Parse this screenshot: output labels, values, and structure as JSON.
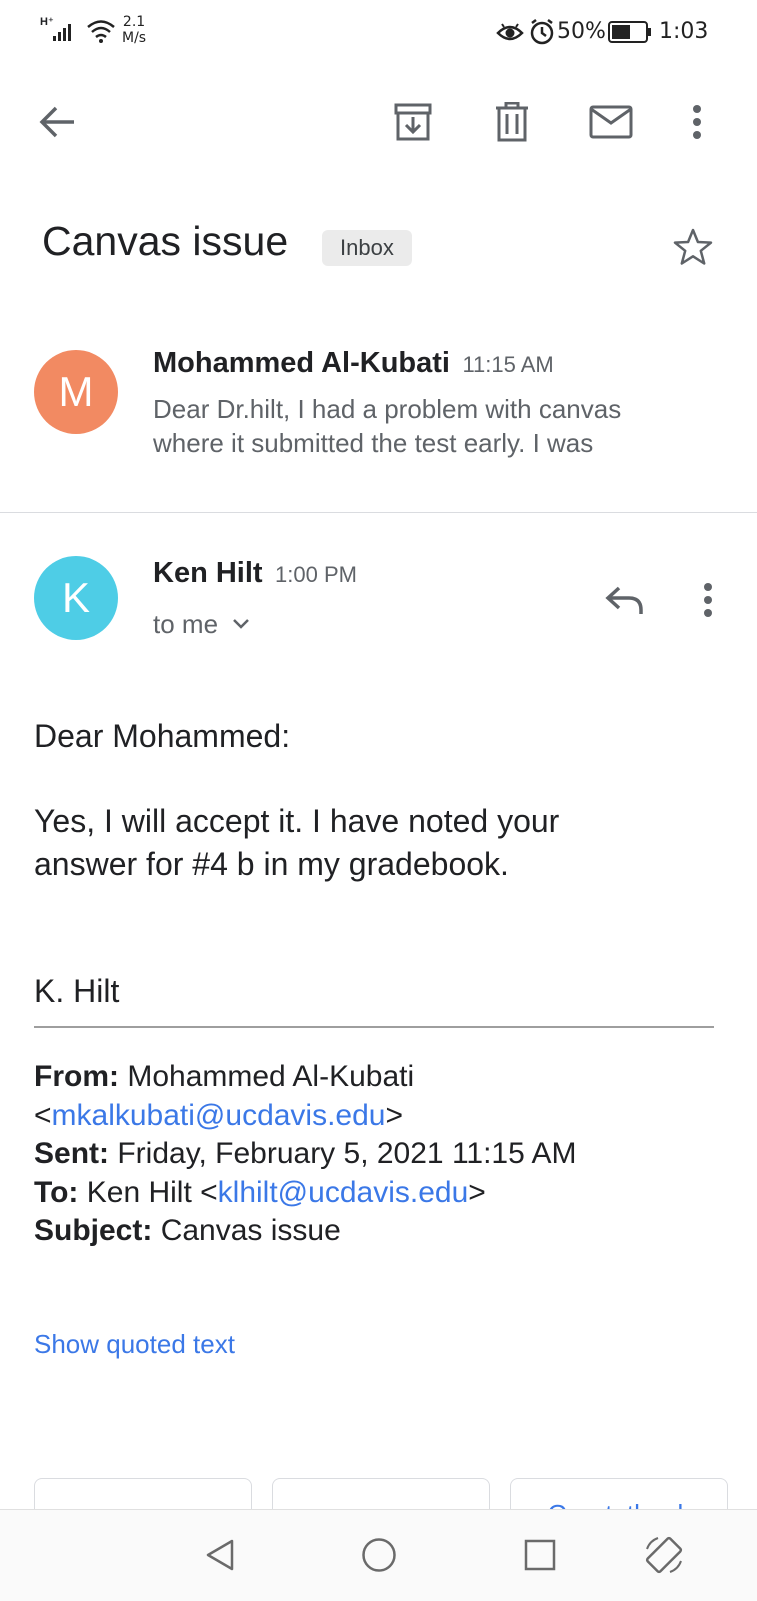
{
  "status_bar": {
    "network": "H⁺",
    "speed_value": "2.1",
    "speed_unit": "M/s",
    "battery": "50%",
    "time": "1:03"
  },
  "toolbar": {
    "icons": [
      "back-arrow-icon",
      "archive-icon",
      "delete-icon",
      "mark-unread-icon",
      "more-vert-icon"
    ]
  },
  "thread": {
    "subject": "Canvas issue",
    "label": "Inbox"
  },
  "messages": [
    {
      "avatar_letter": "M",
      "avatar_color": "#f28a62",
      "sender": "Mohammed Al-Kubati",
      "time": "11:15 AM",
      "snippet_line1": "Dear Dr.hilt, I had a problem with canvas",
      "snippet_line2": "where it submitted the test early. I was"
    },
    {
      "avatar_letter": "K",
      "avatar_color": "#4ecde6",
      "sender": "Ken Hilt",
      "time": "1:00 PM",
      "recipient": "to me"
    }
  ],
  "body": {
    "greeting": "Dear Mohammed:",
    "line1": "Yes, I will accept it. I have noted your",
    "line2": "answer for #4 b in my gradebook.",
    "signature": "K. Hilt"
  },
  "quoted_header": {
    "from_label": "From:",
    "from_name": "Mohammed Al-Kubati",
    "from_open": "<",
    "from_email": "mkalkubati@ucdavis.edu",
    "from_close": ">",
    "sent_label": "Sent:",
    "sent_value": "Friday, February 5, 2021 11:15 AM",
    "to_label": "To:",
    "to_name": "Ken Hilt <",
    "to_email": "klhilt@ucdavis.edu",
    "to_close": ">",
    "subject_label": "Subject:",
    "subject_value": "Canvas issue"
  },
  "show_quoted": "Show quoted text",
  "smart_reply_partial": "Great, thank",
  "colors": {
    "link": "#3b78e7",
    "accent_reply": "#5f6368"
  }
}
